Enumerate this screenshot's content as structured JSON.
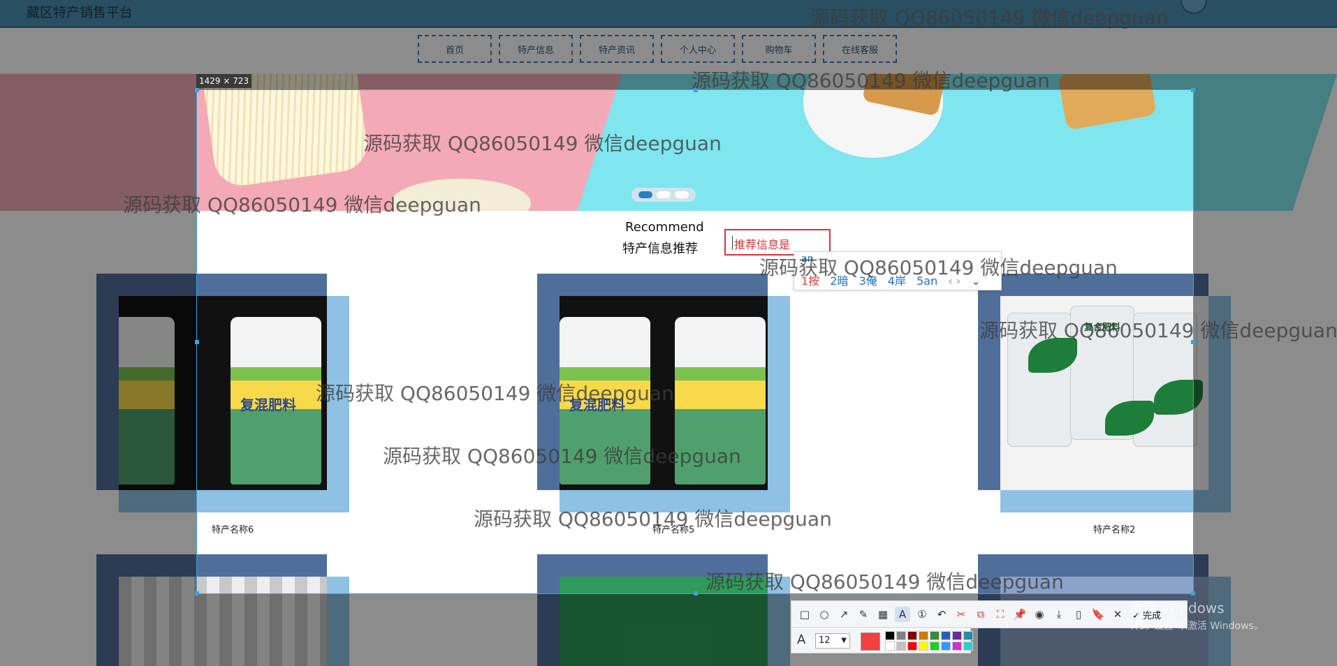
{
  "site": {
    "title": "藏区特产销售平台"
  },
  "nav": {
    "items": [
      {
        "label": "首页",
        "name": "nav-home"
      },
      {
        "label": "特产信息",
        "name": "nav-product-info"
      },
      {
        "label": "特产资讯",
        "name": "nav-product-news"
      },
      {
        "label": "个人中心",
        "name": "nav-profile"
      },
      {
        "label": "购物车",
        "name": "nav-cart"
      },
      {
        "label": "在线客服",
        "name": "nav-support"
      }
    ]
  },
  "recommend": {
    "title": "Recommend",
    "subtitle": "特产信息推荐"
  },
  "text_input": {
    "value": "推荐信息是"
  },
  "ime": {
    "pinyin": "an",
    "candidates": [
      "1按",
      "2暗",
      "3俺",
      "4岸",
      "5an"
    ],
    "next_page": "‹ ›",
    "expand": "⌄"
  },
  "products": [
    {
      "name": "特产名称6",
      "bag_label": "复混肥料"
    },
    {
      "name": "特产名称5",
      "bag_label": "复混肥料"
    },
    {
      "name": "特产名称2",
      "bag_label": "复合肥料"
    }
  ],
  "screenshot_tool": {
    "selection_size": "1429 × 723",
    "tools": [
      {
        "name": "rectangle-tool-icon",
        "glyph": "□"
      },
      {
        "name": "ellipse-tool-icon",
        "glyph": "○"
      },
      {
        "name": "arrow-tool-icon",
        "glyph": "↗"
      },
      {
        "name": "pen-tool-icon",
        "glyph": "✎"
      },
      {
        "name": "mosaic-tool-icon",
        "glyph": "▦"
      },
      {
        "name": "text-tool-icon",
        "glyph": "A"
      },
      {
        "name": "number-tool-icon",
        "glyph": "①"
      },
      {
        "name": "undo-icon",
        "glyph": "↶"
      },
      {
        "name": "smart-shape-icon",
        "glyph": "✂"
      },
      {
        "name": "ocr-icon",
        "glyph": "⧉"
      },
      {
        "name": "scan-icon",
        "glyph": "⛶"
      },
      {
        "name": "pin-icon",
        "glyph": "📌"
      },
      {
        "name": "record-icon",
        "glyph": "◉"
      },
      {
        "name": "download-icon",
        "glyph": "⤓"
      },
      {
        "name": "phone-icon",
        "glyph": "▯"
      },
      {
        "name": "bookmark-icon",
        "glyph": "🔖"
      },
      {
        "name": "close-icon",
        "glyph": "✕"
      }
    ],
    "done_label": "✓ 完成",
    "font_size": "12",
    "current_color": "#f23f3f",
    "palette": [
      "#000000",
      "#808080",
      "#800000",
      "#c88000",
      "#3c8a3c",
      "#2a5fb0",
      "#6a2a9a",
      "#2a8aa0",
      "#ffffff",
      "#c0c0c0",
      "#ff0000",
      "#ffff00",
      "#22cc22",
      "#3399ff",
      "#cc33cc",
      "#33cccc"
    ]
  },
  "watermark": "源码获取 QQ86050149 微信deepguan",
  "windows_activation": {
    "line1": "激活 Windows",
    "line2": "转到\"设置\"以激活 Windows。"
  }
}
